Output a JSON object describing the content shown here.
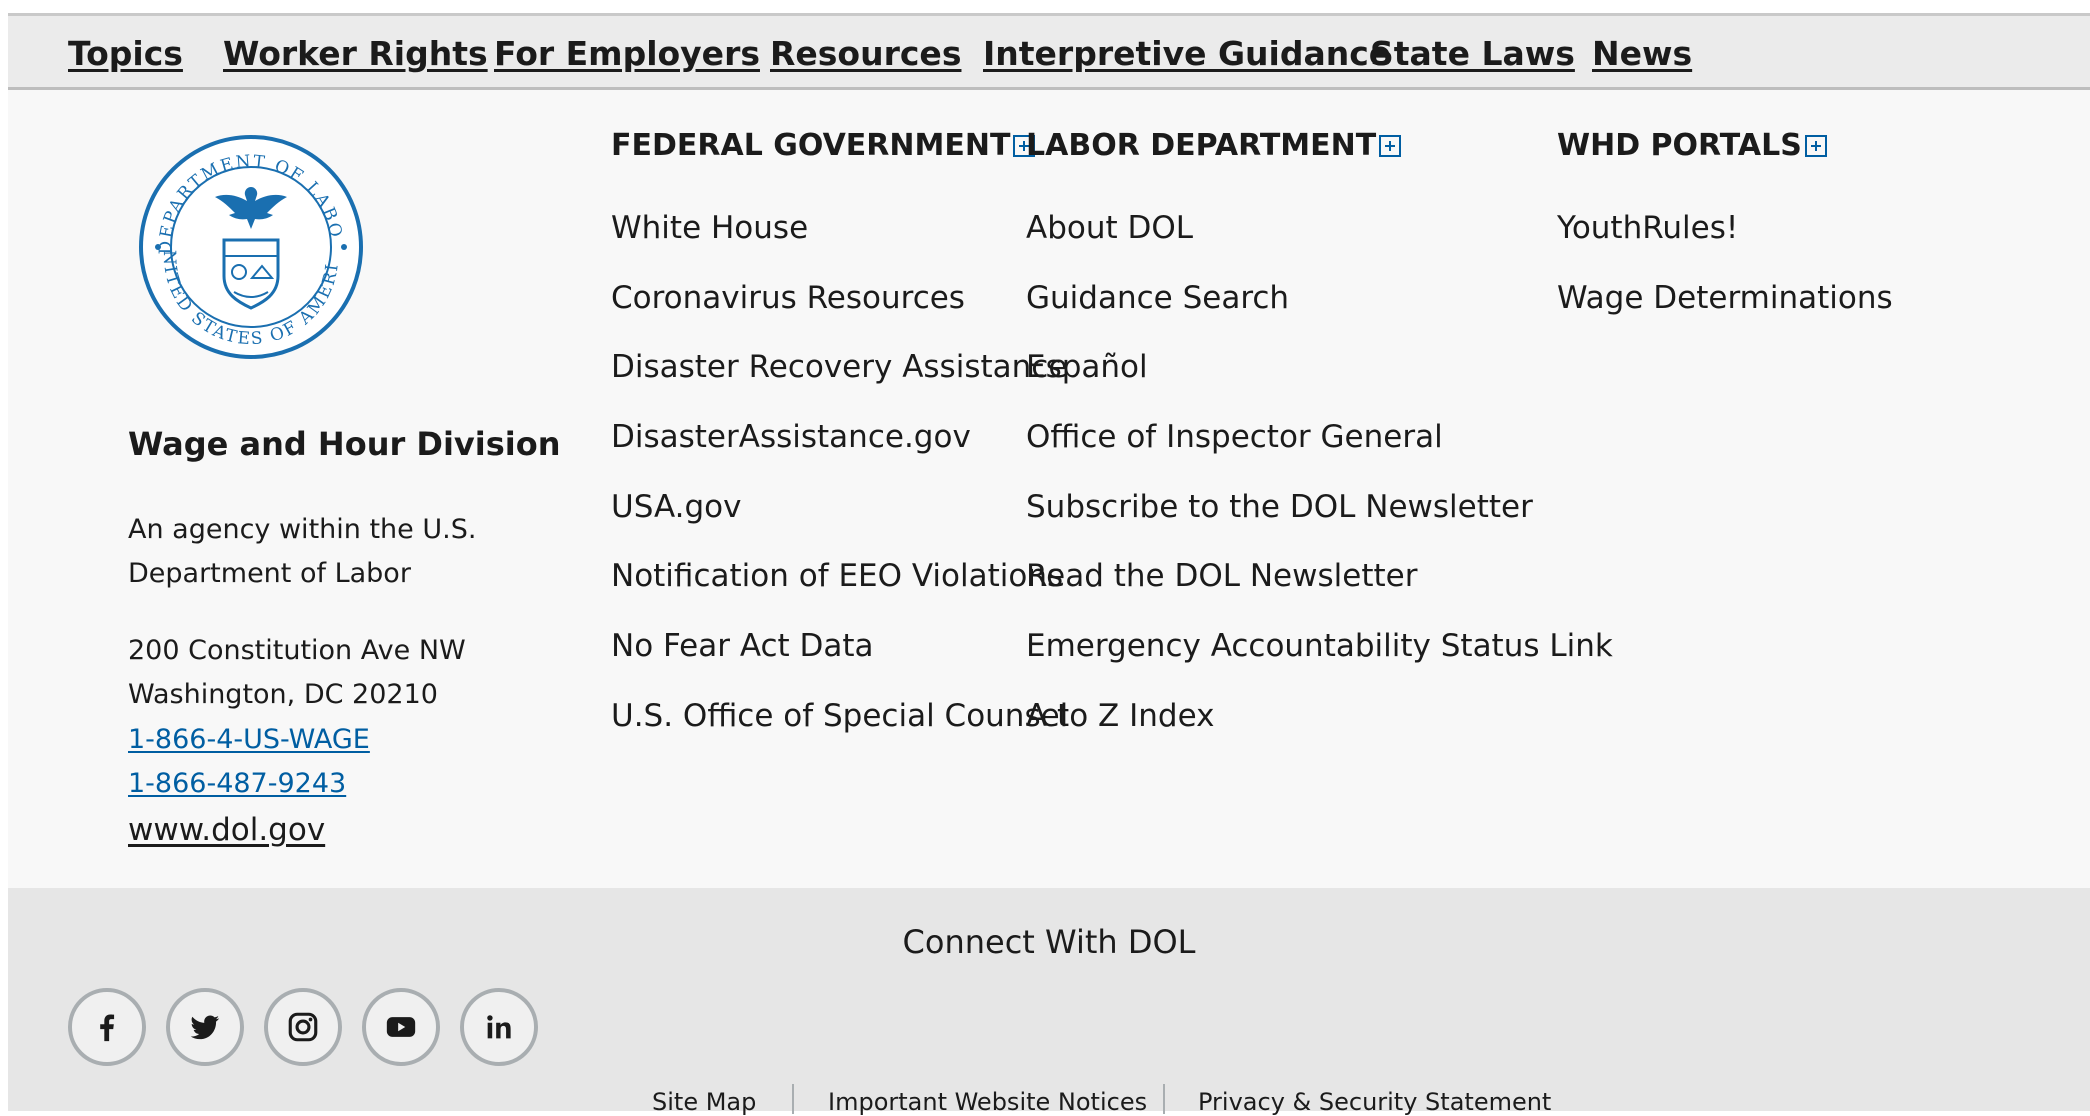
{
  "top_nav": {
    "items": [
      "Topics",
      "Worker Rights",
      "For Employers",
      "Resources",
      "Interpretive Guidance",
      "State Laws",
      "News"
    ]
  },
  "agency": {
    "seal_icon": "dol-seal-icon",
    "seal_text_top": "DEPARTMENT OF LABOR",
    "seal_text_bottom": "UNITED STATES OF AMERICA",
    "name": "Wage and Hour Division",
    "description": "An agency within the U.S. Department of Labor",
    "address_line1": "200 Constitution Ave NW",
    "address_line2": "Washington, DC 20210",
    "phone1": "1-866-4-US-WAGE",
    "phone2": "1-866-487-9243",
    "website": "www.dol.gov"
  },
  "columns": [
    {
      "heading": "FEDERAL GOVERNMENT",
      "links": [
        "White House",
        "Coronavirus Resources",
        "Disaster Recovery Assistance",
        "DisasterAssistance.gov",
        "USA.gov",
        "Notification of EEO Violations",
        "No Fear Act Data",
        "U.S. Office of Special Counsel"
      ]
    },
    {
      "heading": "LABOR DEPARTMENT",
      "links": [
        "About DOL",
        "Guidance Search",
        "Español",
        "Office of Inspector General",
        "Subscribe to the DOL Newsletter",
        "Read the DOL Newsletter",
        "Emergency Accountability Status Link",
        "A to Z Index"
      ]
    },
    {
      "heading": "WHD PORTALS",
      "links": [
        "YouthRules!",
        "Wage Determinations"
      ]
    }
  ],
  "connect": {
    "title": "Connect With DOL",
    "social_icons": [
      "facebook-icon",
      "twitter-icon",
      "instagram-icon",
      "youtube-icon",
      "linkedin-icon"
    ]
  },
  "bottom_links": [
    "Site Map",
    "Important Website Notices",
    "Privacy & Security Statement"
  ],
  "colors": {
    "link_blue": "#005ea2",
    "nav_bg": "#ebebeb",
    "footer_bg": "#f8f8f8",
    "band_bg": "#e6e6e6"
  }
}
